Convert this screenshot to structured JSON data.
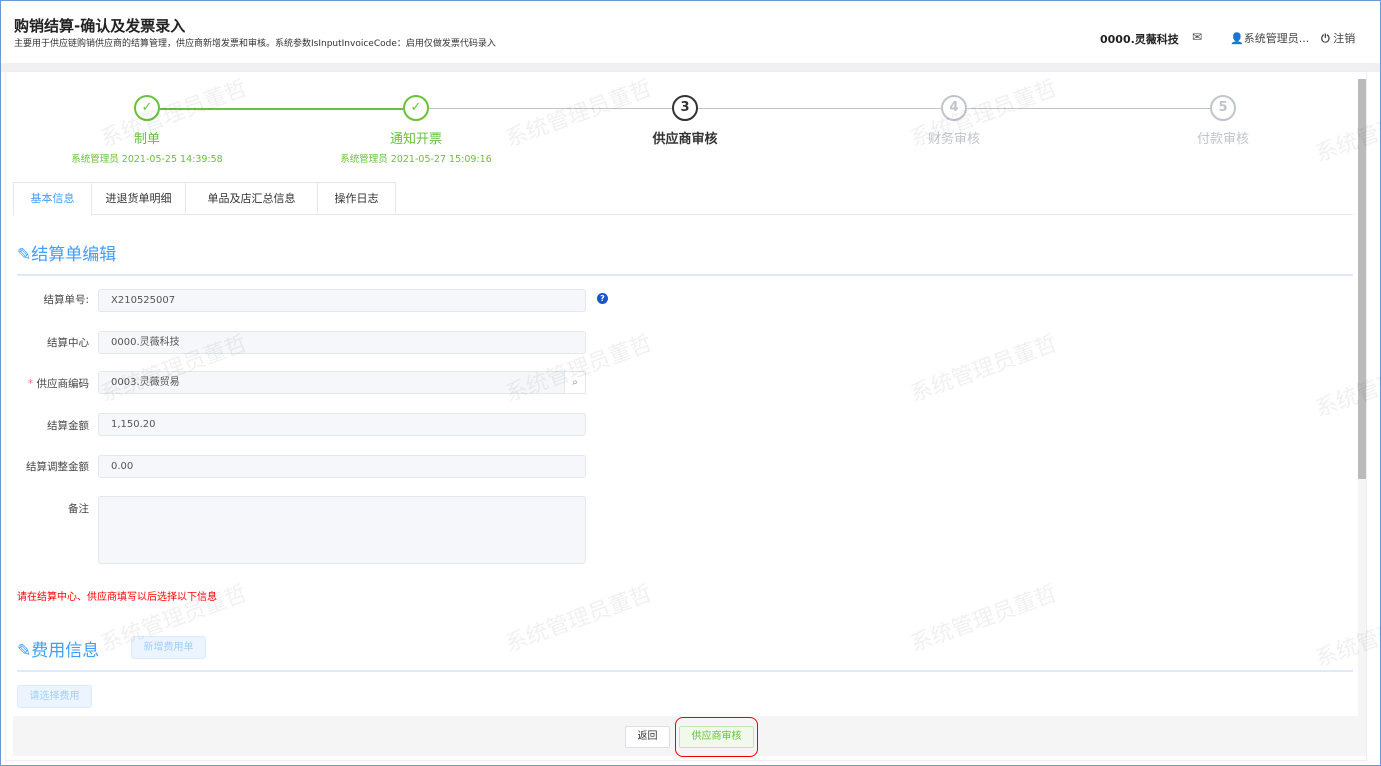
{
  "header": {
    "title": "购销结算-确认及发票录入",
    "subtitle": "主要用于供应链购销供应商的结算管理，供应商新增发票和审核。系统参数IsInputInvoiceCode：启用仅做发票代码录入",
    "org": "0000.灵薇科技",
    "user": "系统管理员...",
    "logout": "注销"
  },
  "steps": [
    {
      "num": "1",
      "label": "制单",
      "sub": "系统管理员 2021-05-25 14:39:58",
      "status": "done"
    },
    {
      "num": "2",
      "label": "通知开票",
      "sub": "系统管理员 2021-05-27 15:09:16",
      "status": "done"
    },
    {
      "num": "3",
      "label": "供应商审核",
      "status": "current"
    },
    {
      "num": "4",
      "label": "财务审核",
      "status": "wait"
    },
    {
      "num": "5",
      "label": "付款审核",
      "status": "wait"
    }
  ],
  "tabs": [
    "基本信息",
    "进退货单明细",
    "单品及店汇总信息",
    "操作日志"
  ],
  "form": {
    "section_title": "结算单编辑",
    "fields": [
      {
        "label": "结算单号:",
        "value": "X210525007"
      },
      {
        "label": "结算中心",
        "value": "0000.灵薇科技"
      },
      {
        "label": "供应商编码",
        "value": "0003.灵薇贸易",
        "required": true
      },
      {
        "label": "结算金额",
        "value": "1,150.20"
      },
      {
        "label": "结算调整金额",
        "value": "0.00"
      }
    ],
    "remark_label": "备注",
    "remark_value": "",
    "hint": "请在结算中心、供应商填写以后选择以下信息"
  },
  "fees": {
    "section_title": "费用信息",
    "add_button": "新增费用单",
    "select_button": "请选择费用"
  },
  "footer": {
    "back": "返回",
    "approve": "供应商审核"
  },
  "watermark": "系统管理员董哲",
  "colors": {
    "accent": "#409eff",
    "success": "#67c23a",
    "error": "#f00"
  }
}
